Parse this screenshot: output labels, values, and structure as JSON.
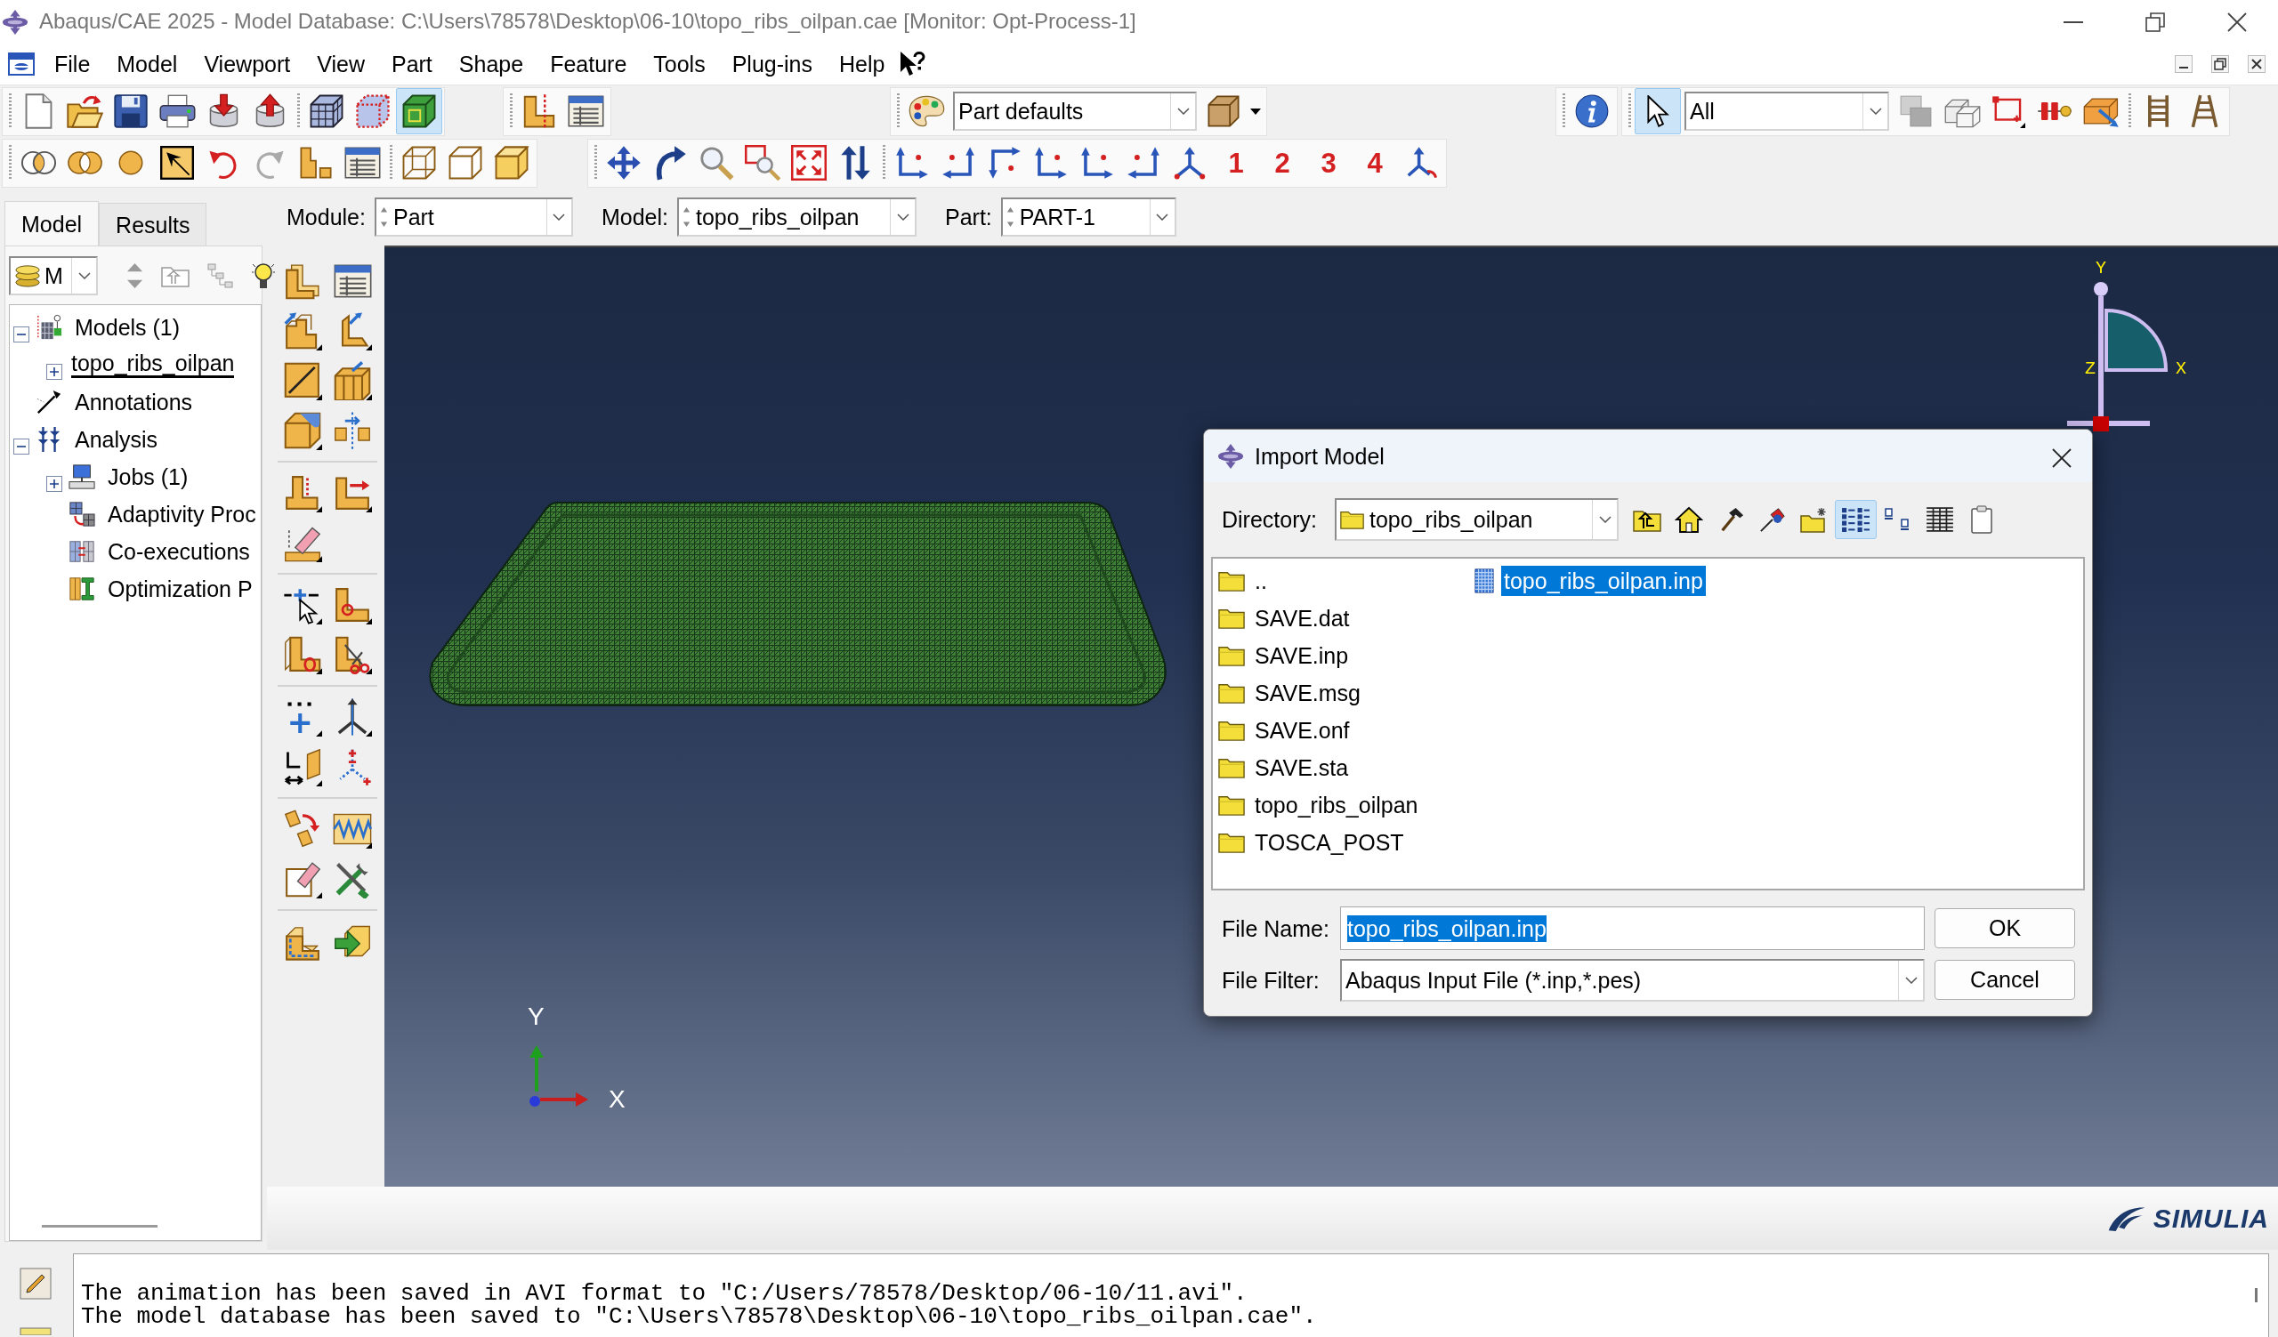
{
  "window": {
    "title": "Abaqus/CAE 2025 - Model Database: C:\\Users\\78578\\Desktop\\06-10\\topo_ribs_oilpan.cae [Monitor: Opt-Process-1]"
  },
  "menu_bar": {
    "items": [
      "File",
      "Model",
      "Viewport",
      "View",
      "Part",
      "Shape",
      "Feature",
      "Tools",
      "Plug-ins",
      "Help"
    ]
  },
  "toolbar": {
    "render_modes": [
      {
        "kind": "mesh",
        "selected": false
      },
      {
        "kind": "dotted",
        "selected": false
      },
      {
        "kind": "shaded",
        "selected": true
      }
    ],
    "render_style": {
      "value": "Part defaults"
    },
    "selection": {
      "pointer_selected": true,
      "filter": "All"
    },
    "view_numbers": [
      "1",
      "2",
      "3",
      "4"
    ]
  },
  "context_bar": {
    "module": {
      "label": "Module:",
      "value": "Part"
    },
    "model": {
      "label": "Model:",
      "value": "topo_ribs_oilpan"
    },
    "part": {
      "label": "Part:",
      "value": "PART-1"
    }
  },
  "panel_tabs": [
    {
      "label": "Model",
      "selected": true
    },
    {
      "label": "Results",
      "selected": false
    }
  ],
  "tree_filter": {
    "value": "M"
  },
  "model_tree": [
    {
      "label": "Models (1)",
      "kind": "models",
      "expanded": true,
      "children": [
        {
          "label": "topo_ribs_oilpan",
          "kind": "model",
          "expanded": false,
          "current": true
        }
      ]
    },
    {
      "label": "Annotations",
      "kind": "annotations"
    },
    {
      "label": "Analysis",
      "kind": "analysis",
      "expanded": true,
      "children": [
        {
          "label": "Jobs (1)",
          "kind": "jobs",
          "expanded": false
        },
        {
          "label": "Adaptivity Proc",
          "kind": "adaptivity"
        },
        {
          "label": "Co-executions",
          "kind": "coexecutions"
        },
        {
          "label": "Optimization P",
          "kind": "optimization"
        }
      ]
    }
  ],
  "viewport": {
    "compass": {
      "y_label": "Y",
      "z_label": "Z",
      "x_label": "X"
    },
    "triad": {
      "y_label": "Y",
      "x_label": "X"
    }
  },
  "footer": {
    "brand": "SIMULIA"
  },
  "dialog": {
    "title": "Import Model",
    "directory": {
      "label": "Directory:",
      "value": "topo_ribs_oilpan"
    },
    "view_modes": [
      {
        "kind": "list",
        "selected": true
      },
      {
        "kind": "icons",
        "selected": false
      },
      {
        "kind": "details",
        "selected": false
      }
    ],
    "entries": [
      {
        "name": "..",
        "kind": "folder",
        "selected": false
      },
      {
        "name": "SAVE.dat",
        "kind": "folder",
        "selected": false
      },
      {
        "name": "SAVE.inp",
        "kind": "folder",
        "selected": false
      },
      {
        "name": "SAVE.msg",
        "kind": "folder",
        "selected": false
      },
      {
        "name": "SAVE.onf",
        "kind": "folder",
        "selected": false
      },
      {
        "name": "SAVE.sta",
        "kind": "folder",
        "selected": false
      },
      {
        "name": "topo_ribs_oilpan",
        "kind": "folder",
        "selected": false
      },
      {
        "name": "TOSCA_POST",
        "kind": "folder",
        "selected": false
      },
      {
        "name": "topo_ribs_oilpan.inp",
        "kind": "file",
        "selected": true
      }
    ],
    "file_name": {
      "label": "File Name:",
      "value": "topo_ribs_oilpan.inp",
      "text_selected": true
    },
    "file_filter": {
      "label": "File Filter:",
      "value": "Abaqus Input File (*.inp,*.pes)"
    },
    "buttons": [
      "OK",
      "Cancel"
    ]
  },
  "message_area": {
    "lines": [
      "The animation has been saved in AVI format to \"C:/Users/78578/Desktop/06-10/11.avi\".",
      "The model database has been saved to \"C:\\Users\\78578\\Desktop\\06-10\\topo_ribs_oilpan.cae\"."
    ]
  }
}
